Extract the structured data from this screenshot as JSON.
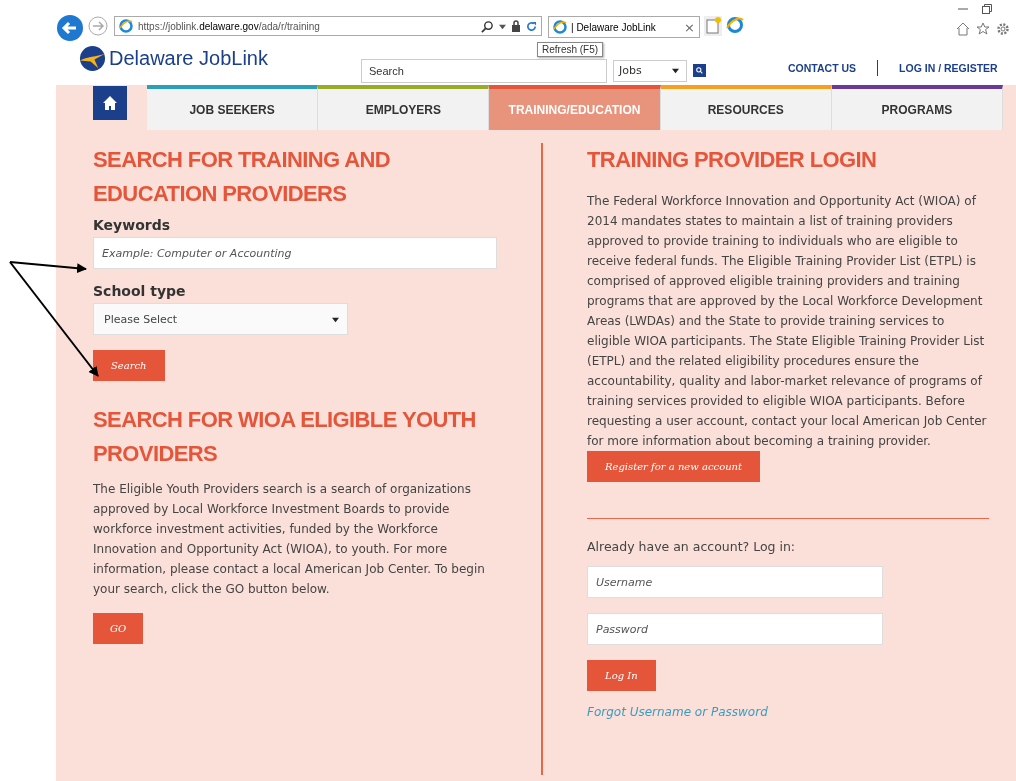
{
  "browser": {
    "url": "https://joblink.**delaware.gov**/ada/r/training",
    "tab_title": "| Delaware JobLink",
    "close_glyph": "×",
    "tooltip": "Refresh (F5)"
  },
  "header": {
    "logo_text": "Delaware JobLink",
    "search": {
      "placeholder": "Search"
    },
    "category": {
      "value": "Jobs"
    },
    "links": [
      "CONTACT US",
      "LOG IN / REGISTER"
    ]
  },
  "nav": {
    "tabs": [
      {
        "label": "JOB SEEKERS",
        "selected": false,
        "color": "#2aa0b8"
      },
      {
        "label": "EMPLOYERS",
        "selected": false,
        "color": "#9aab2a"
      },
      {
        "label": "TRAINING/EDUCATION",
        "selected": true,
        "color": "#e5553a"
      },
      {
        "label": "RESOURCES",
        "selected": false,
        "color": "#f5a01f"
      },
      {
        "label": "PROGRAMS",
        "selected": false,
        "color": "#6a3b96"
      }
    ]
  },
  "training_search": {
    "heading": "SEARCH FOR TRAINING AND EDUCATION PROVIDERS",
    "keywords_label": "Keywords",
    "keywords": {
      "placeholder": "Example: Computer or Accounting"
    },
    "school_type_label": "School type",
    "school_type": {
      "value": "Please Select"
    },
    "search_button": "Search"
  },
  "youth_search": {
    "heading": "SEARCH FOR WIOA ELIGIBLE YOUTH PROVIDERS",
    "text": "The Eligible Youth Providers search is a search of organizations approved by Local Workforce Investment Boards to provide workforce investment activities, funded by the Workforce Innovation and Opportunity Act (WIOA), to youth. For more information, please contact a local American Job Center. To begin your search, click the GO button below.",
    "go_button": "GO"
  },
  "provider_login": {
    "heading": "TRAINING PROVIDER LOGIN",
    "text": "The Federal Workforce Innovation and Opportunity Act (WIOA) of 2014 mandates states to maintain a list of training providers approved to provide training to individuals who are eligible to receive federal funds. The Eligible Training Provider List (ETPL) is comprised of approved eligible training providers and training programs that are approved by the Local Workforce Development Areas (LWDAs) and the State to provide training services to eligible WIOA participants. The State Eligible Training Provider List (ETPL) and the related eligibility procedures ensure the accountability, quality and labor-market relevance of programs of training services provided to eligible WIOA participants. Before requesting a user account, contact your local American Job Center for more information about becoming a training provider.",
    "register_button": "Register for a new account",
    "login_prompt": "Already have an account? Log in:",
    "username": {
      "placeholder": "Username"
    },
    "password": {
      "placeholder": "Password"
    },
    "login_button": "Log In",
    "forgot_link": "Forgot Username or Password"
  }
}
